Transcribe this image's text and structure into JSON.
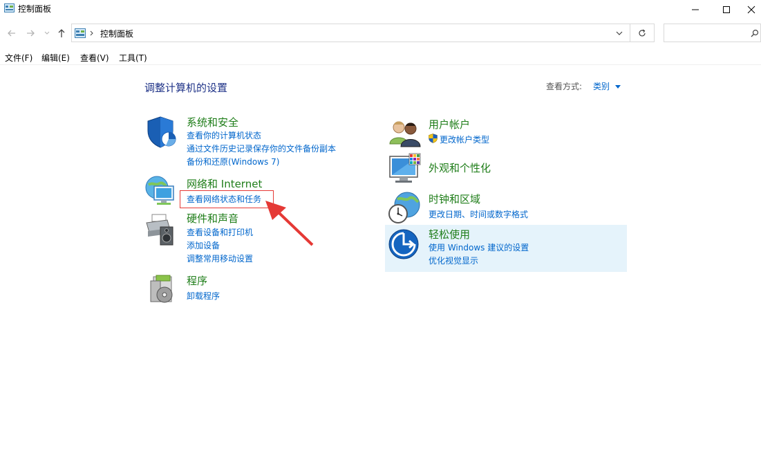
{
  "window": {
    "title": "控制面板"
  },
  "address": {
    "breadcrumb": "控制面板",
    "search_placeholder": ""
  },
  "menu": {
    "file": "文件(F)",
    "edit": "编辑(E)",
    "view": "查看(V)",
    "tools": "工具(T)"
  },
  "content": {
    "heading": "调整计算机的设置",
    "view_by_label": "查看方式:",
    "view_by_value": "类别",
    "left": [
      {
        "title": "系统和安全",
        "links": [
          "查看你的计算机状态",
          "通过文件历史记录保存你的文件备份副本",
          "备份和还原(Windows 7)"
        ]
      },
      {
        "title": "网络和 Internet",
        "links": [
          "查看网络状态和任务"
        ]
      },
      {
        "title": "硬件和声音",
        "links": [
          "查看设备和打印机",
          "添加设备",
          "调整常用移动设置"
        ]
      },
      {
        "title": "程序",
        "links": [
          "卸载程序"
        ]
      }
    ],
    "right": [
      {
        "title": "用户帐户",
        "links": [
          "更改帐户类型"
        ]
      },
      {
        "title": "外观和个性化",
        "links": []
      },
      {
        "title": "时钟和区域",
        "links": [
          "更改日期、时间或数字格式"
        ]
      },
      {
        "title": "轻松使用",
        "links": [
          "使用 Windows 建议的设置",
          "优化视觉显示"
        ]
      }
    ]
  },
  "colors": {
    "category_title": "#1e7d18",
    "link": "#0066cc",
    "heading": "#1e3287",
    "highlight": "#e5f3fb",
    "annotation": "#e53935"
  }
}
